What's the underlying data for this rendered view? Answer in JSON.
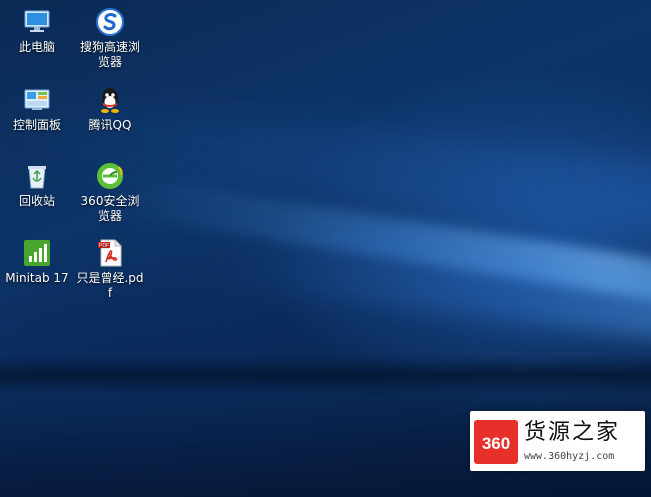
{
  "desktop": {
    "icons": [
      {
        "label": "此电脑",
        "icon": "computer-icon"
      },
      {
        "label": "搜狗高速浏览器",
        "icon": "sogou-browser-icon"
      },
      {
        "label": "控制面板",
        "icon": "control-panel-icon"
      },
      {
        "label": "腾讯QQ",
        "icon": "qq-icon"
      },
      {
        "label": "回收站",
        "icon": "recycle-bin-icon"
      },
      {
        "label": "360安全浏览器",
        "icon": "360-browser-icon"
      },
      {
        "label": "Minitab 17",
        "icon": "minitab-icon"
      },
      {
        "label": "只是曾经.pdf",
        "icon": "pdf-file-icon"
      }
    ]
  },
  "watermark": {
    "logo_text": "360",
    "title": "货源之家",
    "url": "www.360hyzj.com"
  },
  "colors": {
    "desktop_base": "#0b2a55",
    "beam": "#8cc8ff",
    "watermark_red": "#e8302a"
  }
}
